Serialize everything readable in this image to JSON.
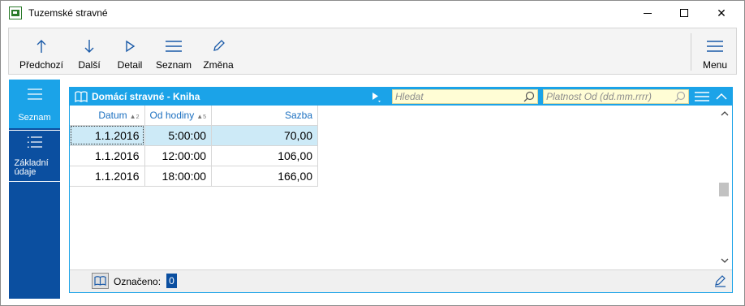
{
  "window": {
    "title": "Tuzemské stravné",
    "minimize_icon": "minimize-icon",
    "maximize_icon": "maximize-icon",
    "close_glyph": "✕"
  },
  "toolbar": {
    "buttons": [
      {
        "label": "Předchozí",
        "icon": "arrow-up-icon"
      },
      {
        "label": "Další",
        "icon": "arrow-down-icon"
      },
      {
        "label": "Detail",
        "icon": "play-outline-icon"
      },
      {
        "label": "Seznam",
        "icon": "list-icon"
      },
      {
        "label": "Změna",
        "icon": "pencil-icon"
      }
    ],
    "menu_label": "Menu"
  },
  "leftnav": {
    "items": [
      {
        "label": "Seznam",
        "icon": "list-icon",
        "active": true
      },
      {
        "label": "Základní údaje",
        "icon": "bulleted-list-icon",
        "active": false
      }
    ],
    "colors": {
      "background": "#0b4fa0",
      "active": "#1ba3e8"
    }
  },
  "panel": {
    "title": "Domácí stravné - Kniha",
    "search_placeholder": "Hledat",
    "date_placeholder": "Platnost Od (dd.mm.rrrr)",
    "header_color": "#1ba3e8"
  },
  "table": {
    "columns": [
      {
        "label": "Datum",
        "sort_index": "2"
      },
      {
        "label": "Od hodiny",
        "sort_index": "5"
      },
      {
        "label": "Sazba",
        "sort_index": ""
      }
    ],
    "rows": [
      {
        "datum": "1.1.2016",
        "od_hodiny": "5:00:00",
        "sazba": "70,00",
        "selected": true
      },
      {
        "datum": "1.1.2016",
        "od_hodiny": "12:00:00",
        "sazba": "106,00",
        "selected": false
      },
      {
        "datum": "1.1.2016",
        "od_hodiny": "18:00:00",
        "sazba": "166,00",
        "selected": false
      }
    ]
  },
  "footer": {
    "marked_label": "Označeno:",
    "marked_count": "0"
  }
}
